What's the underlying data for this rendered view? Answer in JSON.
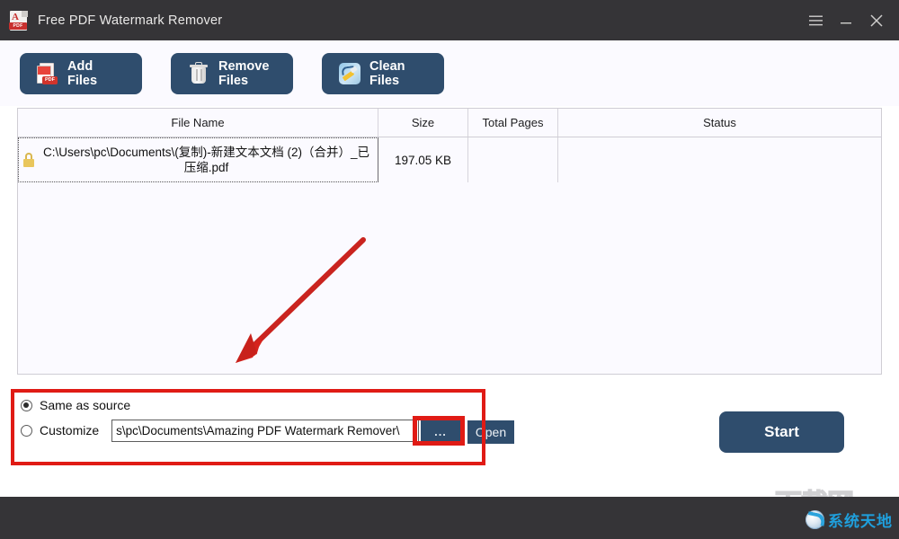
{
  "window": {
    "title": "Free PDF Watermark Remover",
    "app_icon": "pdf-document-icon",
    "icon_band_label": "PDF",
    "controls": {
      "menu": "hamburger-menu-icon",
      "minimize": "minimize-icon",
      "close": "close-icon"
    }
  },
  "toolbar": {
    "add_files": "Add Files",
    "remove_files": "Remove Files",
    "clean_files": "Clean Files"
  },
  "file_list": {
    "columns": [
      "File Name",
      "Size",
      "Total Pages",
      "Status"
    ],
    "rows": [
      {
        "file_name": "C:\\Users\\pc\\Documents\\(复制)-新建文本文档 (2)（合并）_已压缩.pdf",
        "size": "197.05 KB",
        "total_pages": "",
        "status": "",
        "locked": true
      }
    ]
  },
  "output": {
    "same_as_source_label": "Same as source",
    "customize_label": "Customize",
    "selected": "same_as_source",
    "path_value": "s\\pc\\Documents\\Amazing PDF Watermark Remover\\",
    "browse_label": "...",
    "open_label": "Open"
  },
  "actions": {
    "start": "Start"
  },
  "watermark": {
    "ghost_text": "下载网",
    "logo_text": "系统天地",
    "logo_icon": "globe-icon"
  },
  "colors": {
    "titlebar": "#353437",
    "accent_button": "#2f4d6d",
    "annotation_red": "#e01b15",
    "page_background": "#fbfaff"
  }
}
